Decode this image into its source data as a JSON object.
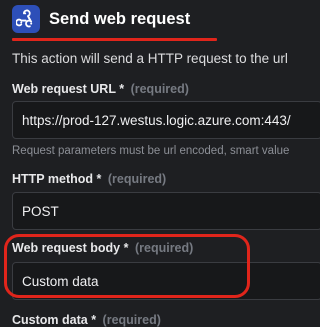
{
  "header": {
    "icon": "webhook-icon",
    "title": "Send web request"
  },
  "description": "This action will send a HTTP request to the url",
  "fields": [
    {
      "label": "Web request URL",
      "required_mark": "*",
      "required_hint": "(required)",
      "value": "https://prod-127.westus.logic.azure.com:443/"
    },
    {
      "label": "HTTP method",
      "required_mark": "*",
      "required_hint": "(required)",
      "value": "POST"
    },
    {
      "label": "Web request body",
      "required_mark": "*",
      "required_hint": "(required)",
      "value": "Custom data"
    },
    {
      "label": "Custom data",
      "required_mark": "*",
      "required_hint": "(required)"
    }
  ],
  "url_helper": "Request parameters must be url encoded, smart value",
  "colors": {
    "background": "#1e1f22",
    "annotation_red": "#e0251b",
    "icon_blue": "#2d4fb8"
  }
}
